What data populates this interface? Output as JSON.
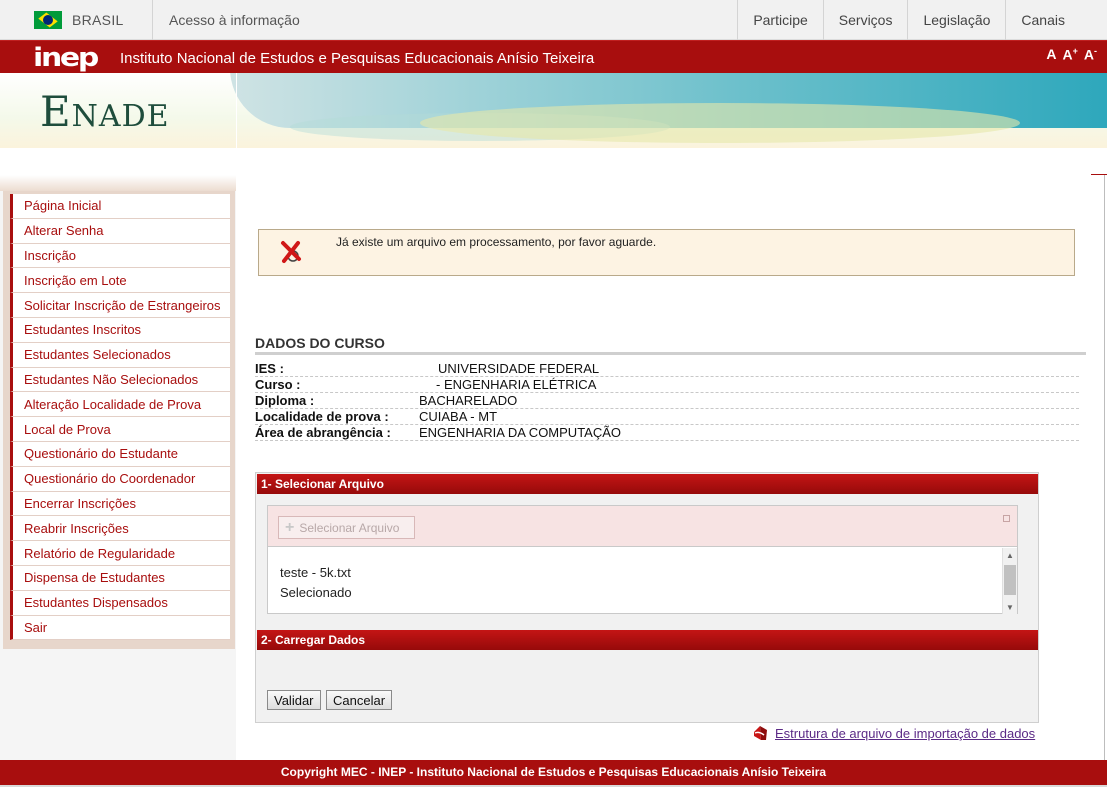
{
  "govbar": {
    "country": "BRASIL",
    "access": "Acesso à informação",
    "links": [
      "Participe",
      "Serviços",
      "Legislação",
      "Canais"
    ]
  },
  "inep": {
    "logo": "inep",
    "title": "Instituto Nacional de Estudos e Pesquisas Educacionais Anísio Teixeira",
    "font_controls": [
      "A",
      "A+",
      "A-"
    ]
  },
  "banner": {
    "logo": "ENADE"
  },
  "menu": {
    "items": [
      "Página Inicial",
      "Alterar Senha",
      "Inscrição",
      "Inscrição em Lote",
      "Solicitar Inscrição de Estrangeiros",
      "Estudantes Inscritos",
      "Estudantes Selecionados",
      "Estudantes Não Selecionados",
      "Alteração Localidade de Prova",
      "Local de Prova",
      "Questionário do Estudante",
      "Questionário do Coordenador",
      "Encerrar Inscrições",
      "Reabrir Inscrições",
      "Relatório de Regularidade",
      "Dispensa de Estudantes",
      "Estudantes Dispensados",
      "Sair"
    ]
  },
  "alert": {
    "icon": "error-x-icon",
    "message": "Já existe um arquivo em processamento, por favor aguarde."
  },
  "course": {
    "title": "DADOS DO CURSO",
    "rows": [
      {
        "label": "IES :",
        "value": "UNIVERSIDADE FEDERAL"
      },
      {
        "label": "Curso :",
        "value": "- ENGENHARIA ELÉTRICA"
      },
      {
        "label": "Diploma :",
        "value": "BACHARELADO"
      },
      {
        "label": "Localidade de prova :",
        "value": "CUIABA - MT"
      },
      {
        "label": "Área de abrangência :",
        "value": "ENGENHARIA DA COMPUTAÇÃO"
      }
    ]
  },
  "upload": {
    "step1_title": "1- Selecionar Arquivo",
    "select_button": "Selecionar Arquivo",
    "file_name": "teste - 5k.txt",
    "file_status": "Selecionado",
    "step2_title": "2- Carregar Dados",
    "validate_button": "Validar",
    "cancel_button": "Cancelar"
  },
  "doc_link": {
    "icon": "pdf-icon",
    "text": "Estrutura de arquivo de importação de dados"
  },
  "footer": {
    "text": "Copyright MEC - INEP - Instituto Nacional de Estudos e Pesquisas Educacionais Anísio Teixeira"
  },
  "colors": {
    "brand_red": "#a80e0e",
    "menu_bg": "#e7d6cb",
    "alert_bg": "#fdf3e3",
    "link_purple": "#5b2a86"
  }
}
